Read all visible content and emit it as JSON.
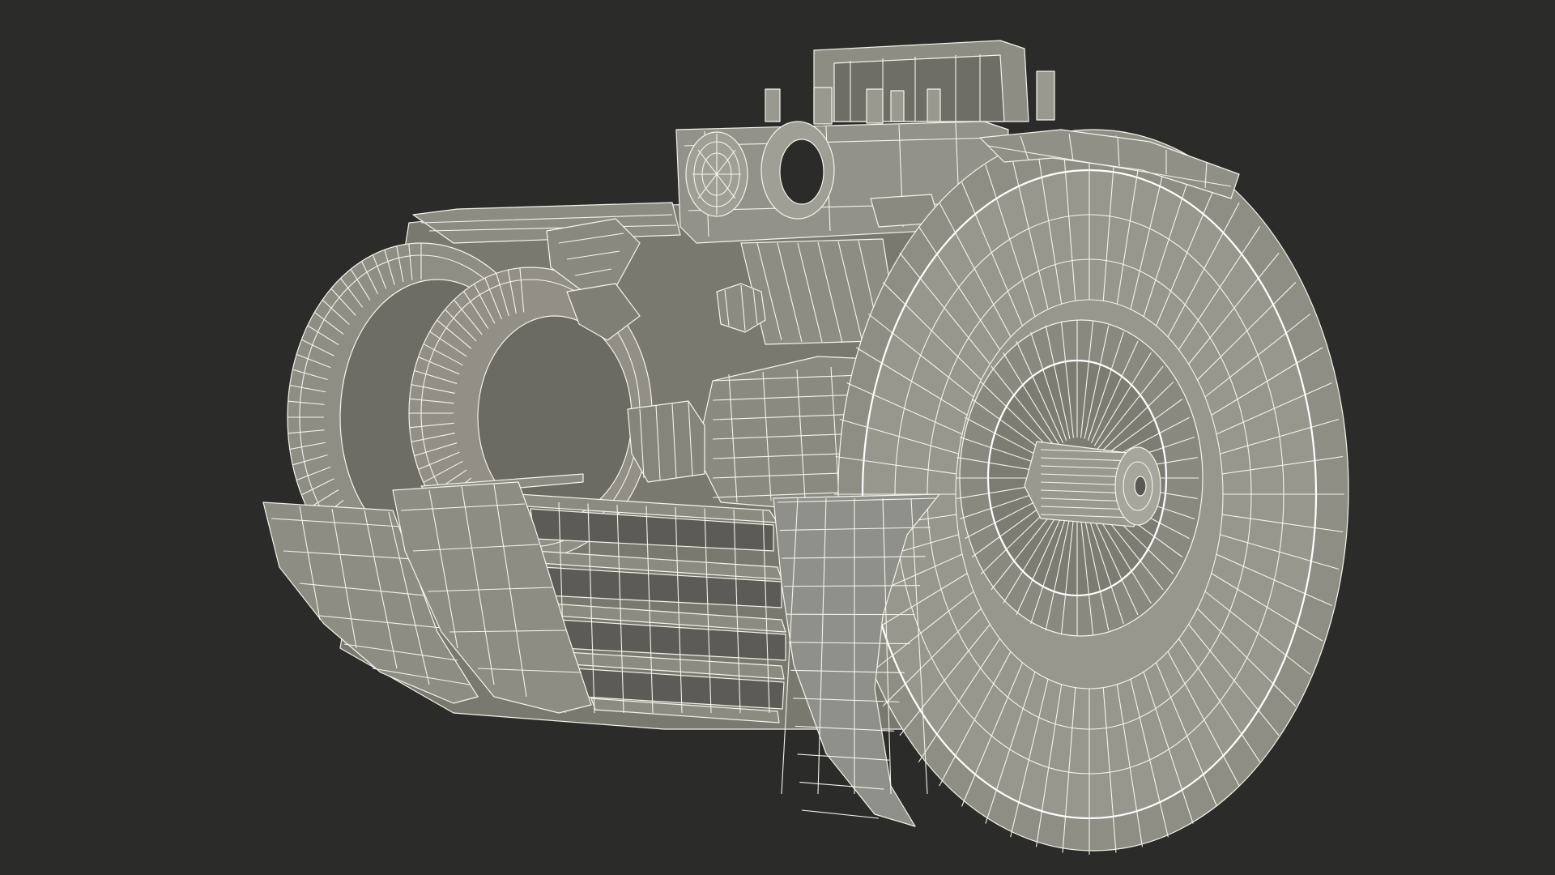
{
  "scene": {
    "subject": "electric-motor-cutaway-wireframe",
    "colors": {
      "background": "#2b2b2a",
      "surface": "#8f8e84",
      "surface_light": "#9d9c91",
      "surface_dark": "#6e6d65",
      "shadow": "#4b4a45",
      "wire": "#f4f4ea"
    }
  }
}
